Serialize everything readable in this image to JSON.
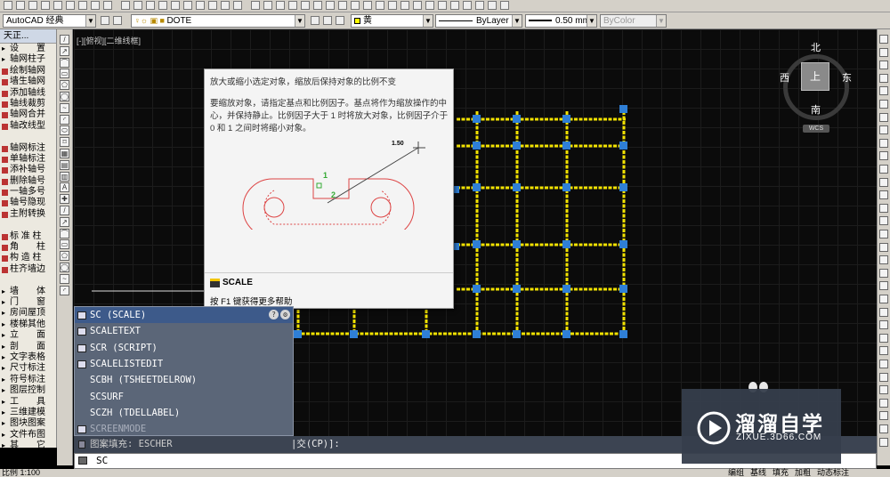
{
  "toolbar": {
    "workspace": "AutoCAD 经典",
    "layer": "DOTE",
    "color": "黄",
    "linetype": "ByLayer",
    "lineweight": "0.50 mm",
    "plotstyle": "ByColor"
  },
  "left_panel": {
    "title": "天正...",
    "items": [
      {
        "label": "设　　置",
        "cat": true
      },
      {
        "label": "轴网柱子",
        "cat": true
      },
      {
        "label": "绘制轴网"
      },
      {
        "label": "墙生轴网"
      },
      {
        "label": "添加轴线"
      },
      {
        "label": "轴线裁剪"
      },
      {
        "label": "轴网合并"
      },
      {
        "label": "轴改线型"
      },
      {
        "label": ""
      },
      {
        "label": "轴网标注"
      },
      {
        "label": "单轴标注"
      },
      {
        "label": "添补轴号"
      },
      {
        "label": "删除轴号"
      },
      {
        "label": "一轴多号"
      },
      {
        "label": "轴号隐现"
      },
      {
        "label": "主附转换"
      },
      {
        "label": ""
      },
      {
        "label": "标 准 柱"
      },
      {
        "label": "角　　柱"
      },
      {
        "label": "构 造 柱"
      },
      {
        "label": "柱齐墙边"
      },
      {
        "label": ""
      },
      {
        "label": "墙　　体",
        "cat": true
      },
      {
        "label": "门　　窗",
        "cat": true
      },
      {
        "label": "房间屋顶",
        "cat": true
      },
      {
        "label": "楼梯其他",
        "cat": true
      },
      {
        "label": "立　　面",
        "cat": true
      },
      {
        "label": "剖　　面",
        "cat": true
      },
      {
        "label": "文字表格",
        "cat": true
      },
      {
        "label": "尺寸标注",
        "cat": true
      },
      {
        "label": "符号标注",
        "cat": true
      },
      {
        "label": "图层控制",
        "cat": true
      },
      {
        "label": "工　　具",
        "cat": true
      },
      {
        "label": "三维建模",
        "cat": true
      },
      {
        "label": "图块图案",
        "cat": true
      },
      {
        "label": "文件布图",
        "cat": true
      },
      {
        "label": "其　　它",
        "cat": true
      },
      {
        "label": "帮助演示",
        "cat": true
      }
    ]
  },
  "viewport_label": "[-][俯视][二维线框]",
  "viewcube": {
    "north": "北",
    "south": "南",
    "east": "东",
    "west": "西",
    "top": "上",
    "wcs": "WCS"
  },
  "tooltip": {
    "summary": "放大或缩小选定对象，缩放后保持对象的比例不变",
    "description": "要缩放对象，请指定基点和比例因子。基点将作为缩放操作的中心，并保持静止。比例因子大于 1 时将放大对象，比例因子介于 0 和 1 之间时将缩小对象。",
    "diagram_value": "1.50",
    "diagram_label1": "1",
    "diagram_label2": "2",
    "command": "SCALE",
    "help": "按 F1 键获得更多帮助"
  },
  "autocomplete": {
    "items": [
      {
        "label": "SC (SCALE)"
      },
      {
        "label": "SCALETEXT"
      },
      {
        "label": "SCR (SCRIPT)"
      },
      {
        "label": "SCALELISTEDIT"
      },
      {
        "label": "SCBH (TSHEETDELROW)"
      },
      {
        "label": "SCSURF"
      },
      {
        "label": "SCZH (TDELLABEL)"
      },
      {
        "label": "SCREENMODE"
      }
    ]
  },
  "command_history": {
    "left": "图案填充: ESCHER",
    "right": "|交(CP)]:"
  },
  "command_input": "SC",
  "statusbar": {
    "scale": "比例 1:100",
    "items": [
      "编组",
      "基线",
      "填充",
      "加粗",
      "动态标注"
    ]
  },
  "watermark": {
    "brand": "溜溜自学",
    "url": "ZIXUE.3D66.COM"
  }
}
